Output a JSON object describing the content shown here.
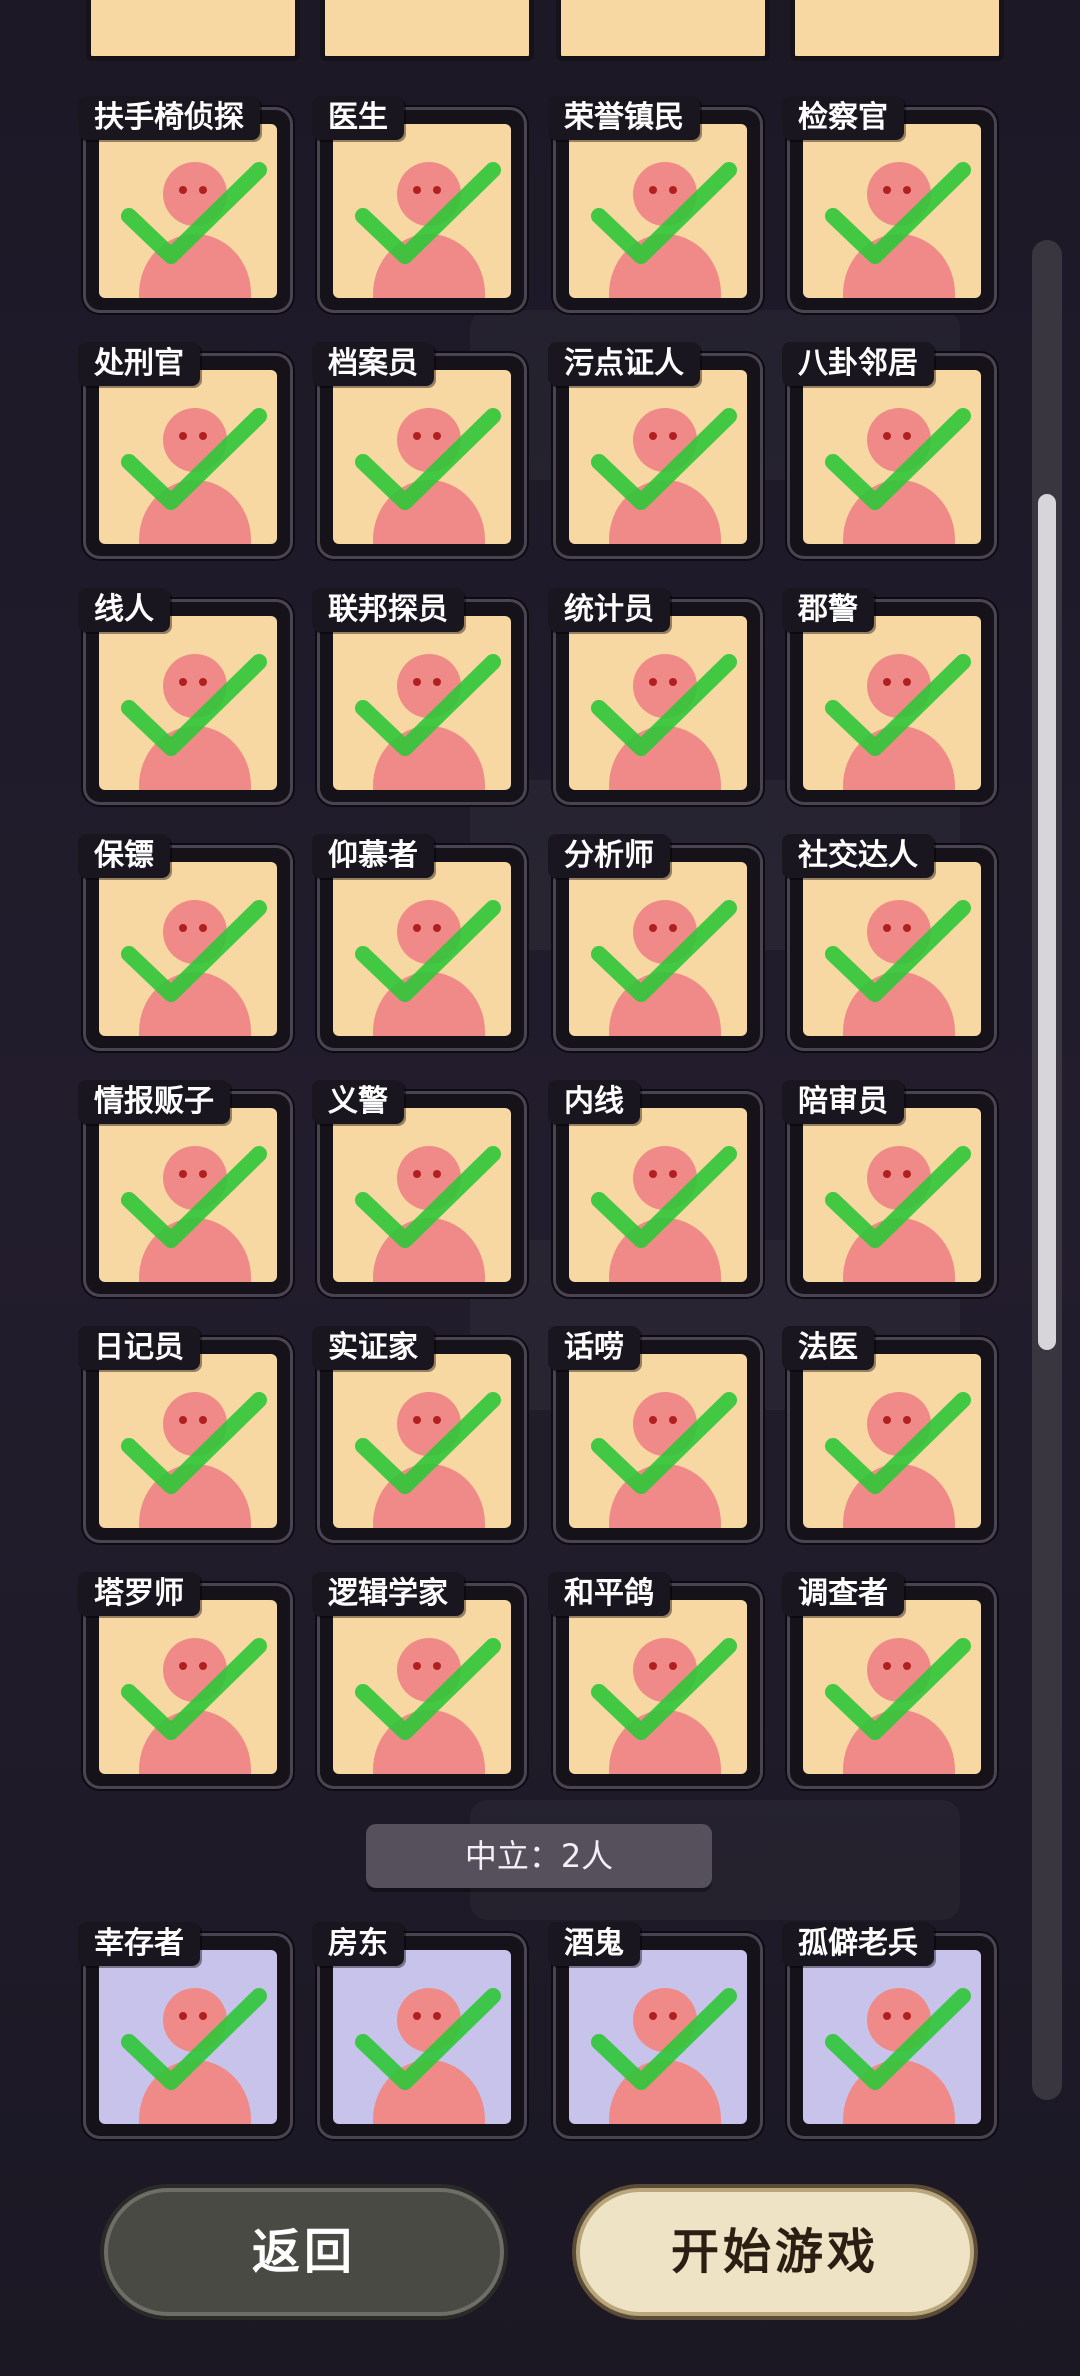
{
  "roles_good": [
    {
      "name": "扶手椅侦探",
      "icon": "armchair-icon"
    },
    {
      "name": "医生",
      "icon": "syringe-icon"
    },
    {
      "name": "荣誉镇民",
      "icon": "medal-icon"
    },
    {
      "name": "检察官",
      "icon": "badge-laurel-icon"
    },
    {
      "name": "处刑官",
      "icon": "axe-icon"
    },
    {
      "name": "档案员",
      "icon": "archive-icon"
    },
    {
      "name": "污点证人",
      "icon": "scales-handshake-icon"
    },
    {
      "name": "八卦邻居",
      "icon": "whisper-icon"
    },
    {
      "name": "线人",
      "icon": "pointing-icon"
    },
    {
      "name": "联邦探员",
      "icon": "fbi-icon"
    },
    {
      "name": "统计员",
      "icon": "bar-chart-icon"
    },
    {
      "name": "郡警",
      "icon": "sheriff-star-icon"
    },
    {
      "name": "保镖",
      "icon": "bodyguards-icon"
    },
    {
      "name": "仰慕者",
      "icon": "roses-icon"
    },
    {
      "name": "分析师",
      "icon": "papers-icon"
    },
    {
      "name": "社交达人",
      "icon": "door-wave-icon"
    },
    {
      "name": "情报贩子",
      "icon": "whisper-hand-icon"
    },
    {
      "name": "义警",
      "icon": "pistol-icon"
    },
    {
      "name": "内线",
      "icon": "envelope-x-icon"
    },
    {
      "name": "陪审员",
      "icon": "thinking-icon"
    },
    {
      "name": "日记员",
      "icon": "locked-diary-icon"
    },
    {
      "name": "实证家",
      "icon": "head-plus-icon"
    },
    {
      "name": "话唠",
      "icon": "speech-bubbles-icon"
    },
    {
      "name": "法医",
      "icon": "mask-icon"
    },
    {
      "name": "塔罗师",
      "icon": "tarot-icon"
    },
    {
      "name": "逻辑学家",
      "icon": "formula-icon"
    },
    {
      "name": "和平鸽",
      "icon": "dove-icon"
    },
    {
      "name": "调查者",
      "icon": "magnifier-icon"
    }
  ],
  "neutral_section": {
    "label": "中立：2人"
  },
  "roles_neutral": [
    {
      "name": "幸存者",
      "icon": "vest-icon"
    },
    {
      "name": "房东",
      "icon": "keys-icon"
    },
    {
      "name": "酒鬼",
      "icon": "drinking-icon"
    },
    {
      "name": "孤僻老兵",
      "icon": "rifle-icon"
    }
  ],
  "buttons": {
    "back": "返回",
    "start": "开始游戏"
  },
  "colors": {
    "good_bg": "#f8d8a2",
    "neutral_bg": "#c7c3ea",
    "check": "#2fc63a",
    "figure": "#f08a88"
  }
}
